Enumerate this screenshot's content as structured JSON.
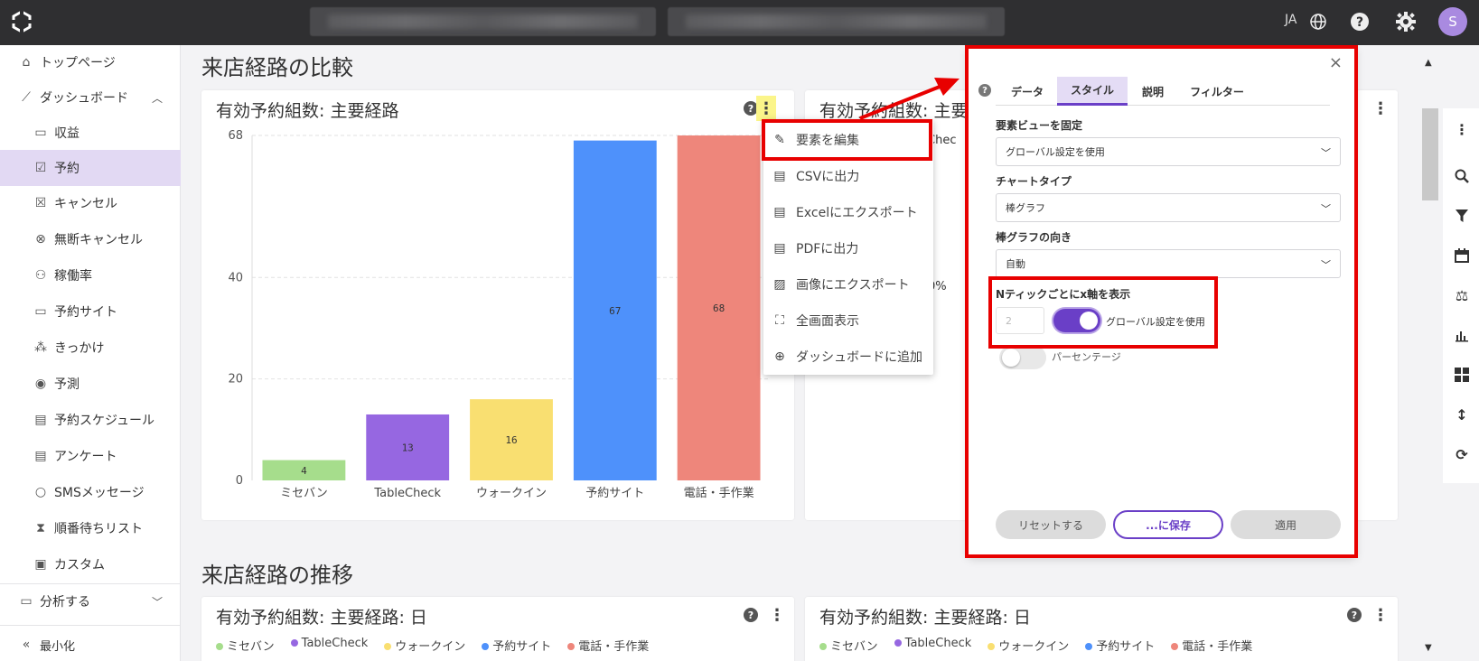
{
  "topbar": {
    "lang": "JA",
    "avatar_initial": "S",
    "icons": [
      "app-logo-icon",
      "globe-icon",
      "help-icon",
      "gear-icon"
    ]
  },
  "sidebar": {
    "items": [
      {
        "label": "トップページ",
        "icon": "home-icon"
      },
      {
        "label": "ダッシュボード",
        "icon": "chart-icon"
      },
      {
        "label": "収益",
        "icon": "money-icon"
      },
      {
        "label": "予約",
        "icon": "calendar-check-icon"
      },
      {
        "label": "キャンセル",
        "icon": "calendar-x-icon"
      },
      {
        "label": "無断キャンセル",
        "icon": "circle-x-icon"
      },
      {
        "label": "稼働率",
        "icon": "people-icon"
      },
      {
        "label": "予約サイト",
        "icon": "monitor-icon"
      },
      {
        "label": "きっかけ",
        "icon": "network-icon"
      },
      {
        "label": "予測",
        "icon": "eye-icon"
      },
      {
        "label": "予約スケジュール",
        "icon": "schedule-icon"
      },
      {
        "label": "アンケート",
        "icon": "survey-icon"
      },
      {
        "label": "SMSメッセージ",
        "icon": "message-icon"
      },
      {
        "label": "順番待ちリスト",
        "icon": "hourglass-icon"
      },
      {
        "label": "カスタム",
        "icon": "custom-icon"
      },
      {
        "label": "分析する",
        "icon": "analyze-icon"
      }
    ],
    "minimize": "最小化"
  },
  "main": {
    "section1_title": "来店経路の比較",
    "section2_title": "来店経路の推移",
    "card1_title": "有効予約組数: 主要経路",
    "card2_title": "有効予約組数: 主要",
    "card2_partial": "eChec",
    "card2_pct": "0%",
    "card3_title": "有効予約組数: 主要経路: 日",
    "card4_title": "有効予約組数: 主要経路: 日",
    "help_symbol": "?",
    "menu_symbol": "⋮"
  },
  "chart_data": {
    "type": "bar",
    "categories": [
      "ミセバン",
      "TableCheck",
      "ウォークイン",
      "予約サイト",
      "電話・手作業"
    ],
    "values": [
      4,
      13,
      16,
      67,
      68
    ],
    "colors": [
      "#a6dd8c",
      "#9667e1",
      "#f9df71",
      "#4e91fb",
      "#ee867b"
    ],
    "y_ticks": [
      "0",
      "20",
      "40",
      "68"
    ],
    "y_tick_values": [
      0,
      20,
      40,
      68
    ],
    "ylim": [
      0,
      68
    ],
    "grid": true
  },
  "legend": [
    {
      "label": "ミセバン",
      "color": "#a6dd8c"
    },
    {
      "label": "TableCheck",
      "color": "#9667e1"
    },
    {
      "label": "ウォークイン",
      "color": "#f9df71"
    },
    {
      "label": "予約サイト",
      "color": "#4e91fb"
    },
    {
      "label": "電話・手作業",
      "color": "#ee867b"
    }
  ],
  "dropdown": {
    "items": [
      {
        "label": "要素を編集",
        "icon": "edit-icon"
      },
      {
        "label": "CSVに出力",
        "icon": "csv-icon"
      },
      {
        "label": "Excelにエクスポート",
        "icon": "excel-icon"
      },
      {
        "label": "PDFに出力",
        "icon": "pdf-icon"
      },
      {
        "label": "画像にエクスポート",
        "icon": "image-icon"
      },
      {
        "label": "全画面表示",
        "icon": "fullscreen-icon"
      },
      {
        "label": "ダッシュボードに追加",
        "icon": "add-circle-icon"
      }
    ]
  },
  "panel": {
    "close": "×",
    "tabs": [
      "データ",
      "スタイル",
      "説明",
      "フィルター"
    ],
    "active_tab": "スタイル",
    "fix_view_label": "要素ビューを固定",
    "fix_view_value": "グローバル設定を使用",
    "chart_type_label": "チャートタイプ",
    "chart_type_value": "棒グラフ",
    "orientation_label": "棒グラフの向き",
    "orientation_value": "自動",
    "ntick_label": "Nティックごとにx軸を表示",
    "ntick_value": "2",
    "ntick_toggle_label": "グローバル設定を使用",
    "ntick_toggle_on": true,
    "percentage_label": "パーセンテージ",
    "percentage_on": false,
    "reset_button": "リセットする",
    "save_button": "...に保存",
    "apply_button": "適用",
    "accent_color": "#6a3fc7"
  },
  "right_tools": [
    "more-icon",
    "search-icon",
    "filter-icon",
    "calendar-icon",
    "balance-icon",
    "bar-chart-icon",
    "grid-icon",
    "sort-icon",
    "refresh-icon"
  ]
}
